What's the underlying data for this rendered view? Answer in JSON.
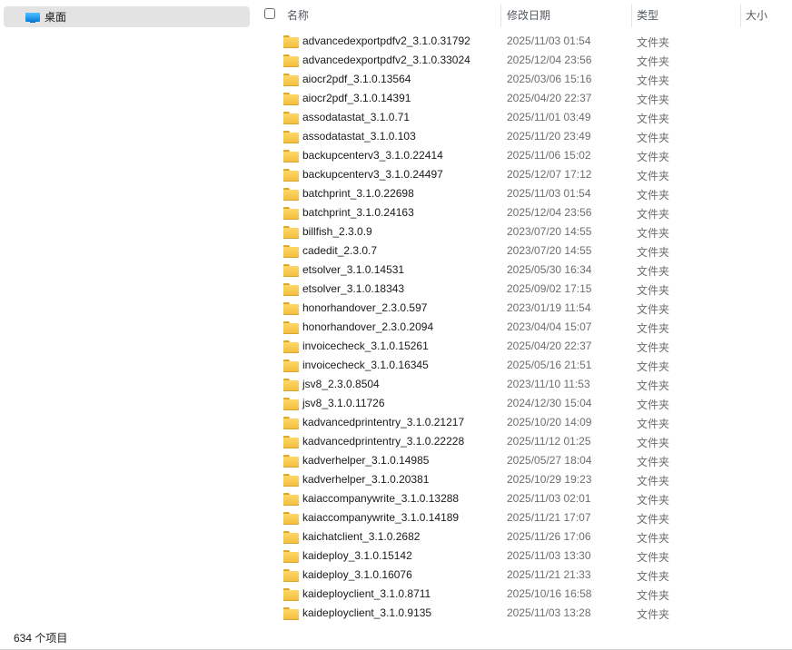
{
  "nav": {
    "items": [
      {
        "label": "桌面",
        "icon": "desktop-icon"
      }
    ]
  },
  "header": {
    "name": "名称",
    "modified": "修改日期",
    "type": "类型",
    "size": "大小"
  },
  "files": [
    {
      "name": "advancedexportpdfv2_3.1.0.31792",
      "date": "2025/11/03 01:54",
      "type": "文件夹"
    },
    {
      "name": "advancedexportpdfv2_3.1.0.33024",
      "date": "2025/12/04 23:56",
      "type": "文件夹"
    },
    {
      "name": "aiocr2pdf_3.1.0.13564",
      "date": "2025/03/06 15:16",
      "type": "文件夹"
    },
    {
      "name": "aiocr2pdf_3.1.0.14391",
      "date": "2025/04/20 22:37",
      "type": "文件夹"
    },
    {
      "name": "assodatastat_3.1.0.71",
      "date": "2025/11/01 03:49",
      "type": "文件夹"
    },
    {
      "name": "assodatastat_3.1.0.103",
      "date": "2025/11/20 23:49",
      "type": "文件夹"
    },
    {
      "name": "backupcenterv3_3.1.0.22414",
      "date": "2025/11/06 15:02",
      "type": "文件夹"
    },
    {
      "name": "backupcenterv3_3.1.0.24497",
      "date": "2025/12/07 17:12",
      "type": "文件夹"
    },
    {
      "name": "batchprint_3.1.0.22698",
      "date": "2025/11/03 01:54",
      "type": "文件夹"
    },
    {
      "name": "batchprint_3.1.0.24163",
      "date": "2025/12/04 23:56",
      "type": "文件夹"
    },
    {
      "name": "billfish_2.3.0.9",
      "date": "2023/07/20 14:55",
      "type": "文件夹"
    },
    {
      "name": "cadedit_2.3.0.7",
      "date": "2023/07/20 14:55",
      "type": "文件夹"
    },
    {
      "name": "etsolver_3.1.0.14531",
      "date": "2025/05/30 16:34",
      "type": "文件夹"
    },
    {
      "name": "etsolver_3.1.0.18343",
      "date": "2025/09/02 17:15",
      "type": "文件夹"
    },
    {
      "name": "honorhandover_2.3.0.597",
      "date": "2023/01/19 11:54",
      "type": "文件夹"
    },
    {
      "name": "honorhandover_2.3.0.2094",
      "date": "2023/04/04 15:07",
      "type": "文件夹"
    },
    {
      "name": "invoicecheck_3.1.0.15261",
      "date": "2025/04/20 22:37",
      "type": "文件夹"
    },
    {
      "name": "invoicecheck_3.1.0.16345",
      "date": "2025/05/16 21:51",
      "type": "文件夹"
    },
    {
      "name": "jsv8_2.3.0.8504",
      "date": "2023/11/10 11:53",
      "type": "文件夹"
    },
    {
      "name": "jsv8_3.1.0.11726",
      "date": "2024/12/30 15:04",
      "type": "文件夹"
    },
    {
      "name": "kadvancedprintentry_3.1.0.21217",
      "date": "2025/10/20 14:09",
      "type": "文件夹"
    },
    {
      "name": "kadvancedprintentry_3.1.0.22228",
      "date": "2025/11/12 01:25",
      "type": "文件夹"
    },
    {
      "name": "kadverhelper_3.1.0.14985",
      "date": "2025/05/27 18:04",
      "type": "文件夹"
    },
    {
      "name": "kadverhelper_3.1.0.20381",
      "date": "2025/10/29 19:23",
      "type": "文件夹"
    },
    {
      "name": "kaiaccompanywrite_3.1.0.13288",
      "date": "2025/11/03 02:01",
      "type": "文件夹"
    },
    {
      "name": "kaiaccompanywrite_3.1.0.14189",
      "date": "2025/11/21 17:07",
      "type": "文件夹"
    },
    {
      "name": "kaichatclient_3.1.0.2682",
      "date": "2025/11/26 17:06",
      "type": "文件夹"
    },
    {
      "name": "kaideploy_3.1.0.15142",
      "date": "2025/11/03 13:30",
      "type": "文件夹"
    },
    {
      "name": "kaideploy_3.1.0.16076",
      "date": "2025/11/21 21:33",
      "type": "文件夹"
    },
    {
      "name": "kaideployclient_3.1.0.8711",
      "date": "2025/10/16 16:58",
      "type": "文件夹"
    },
    {
      "name": "kaideployclient_3.1.0.9135",
      "date": "2025/11/03 13:28",
      "type": "文件夹"
    }
  ],
  "status": {
    "count": "634 个项目"
  }
}
